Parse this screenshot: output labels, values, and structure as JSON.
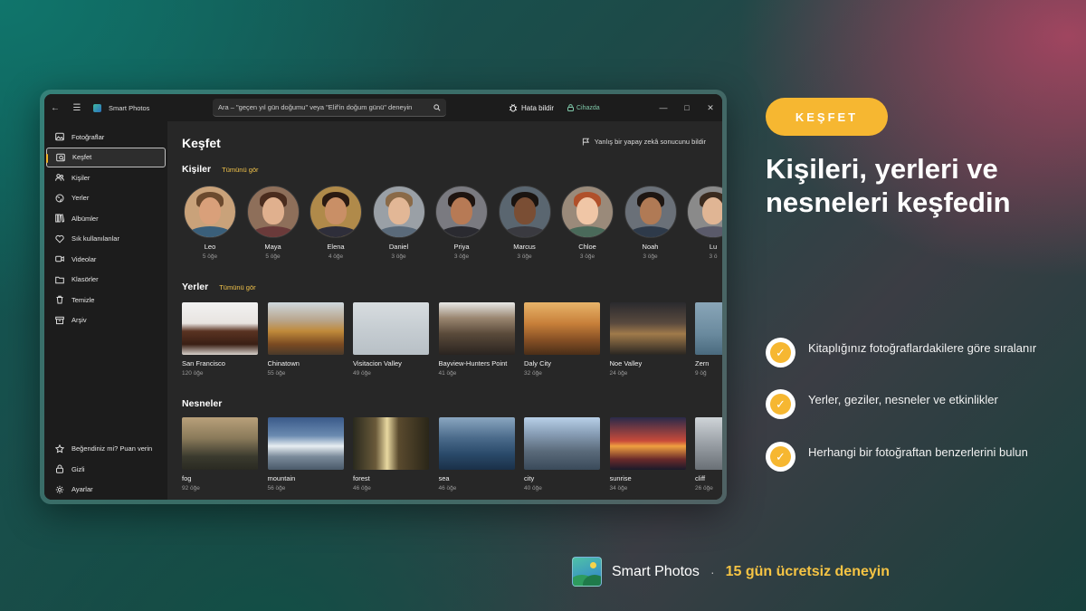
{
  "titlebar": {
    "app_title": "Smart Photos",
    "search_placeholder": "Ara – \"geçen yıl gün doğumu\" veya \"Elif'in doğum günü\" deneyin",
    "report_bug": "Hata bildir",
    "device": "Cihazda"
  },
  "sidebar": {
    "items": [
      {
        "label": "Fotoğraflar",
        "icon": "photo-icon"
      },
      {
        "label": "Keşfet",
        "icon": "explore-icon"
      },
      {
        "label": "Kişiler",
        "icon": "people-icon"
      },
      {
        "label": "Yerler",
        "icon": "globe-icon"
      },
      {
        "label": "Albümler",
        "icon": "album-icon"
      },
      {
        "label": "Sık kullanılanlar",
        "icon": "heart-icon"
      },
      {
        "label": "Videolar",
        "icon": "video-icon"
      },
      {
        "label": "Klasörler",
        "icon": "folder-icon"
      },
      {
        "label": "Temizle",
        "icon": "trash-icon"
      },
      {
        "label": "Arşiv",
        "icon": "archive-icon"
      }
    ],
    "bottom": [
      {
        "label": "Beğendiniz mi? Puan verin",
        "icon": "star-icon"
      },
      {
        "label": "Gizli",
        "icon": "lock-icon"
      },
      {
        "label": "Ayarlar",
        "icon": "gear-icon"
      }
    ]
  },
  "main": {
    "title": "Keşfet",
    "ai_report": "Yanlış bir yapay zekâ sonucunu bildir",
    "people": {
      "title": "Kişiler",
      "link": "Tümünü gör",
      "items": [
        {
          "name": "Leo",
          "count": "5 öğe"
        },
        {
          "name": "Maya",
          "count": "5 öğe"
        },
        {
          "name": "Elena",
          "count": "4 öğe"
        },
        {
          "name": "Daniel",
          "count": "3 öğe"
        },
        {
          "name": "Priya",
          "count": "3 öğe"
        },
        {
          "name": "Marcus",
          "count": "3 öğe"
        },
        {
          "name": "Chloe",
          "count": "3 öğe"
        },
        {
          "name": "Noah",
          "count": "3 öğe"
        },
        {
          "name": "Lu",
          "count": "3 ö"
        }
      ]
    },
    "places": {
      "title": "Yerler",
      "link": "Tümünü gör",
      "items": [
        {
          "name": "San Francisco",
          "count": "120 öğe"
        },
        {
          "name": "Chinatown",
          "count": "55 öğe"
        },
        {
          "name": "Visitacion Valley",
          "count": "49 öğe"
        },
        {
          "name": "Bayview-Hunters Point",
          "count": "41 öğe"
        },
        {
          "name": "Daly City",
          "count": "32 öğe"
        },
        {
          "name": "Noe Valley",
          "count": "24 öğe"
        },
        {
          "name": "Zern",
          "count": "9 öğ"
        }
      ]
    },
    "objects": {
      "title": "Nesneler",
      "items": [
        {
          "name": "fog",
          "count": "92 öğe"
        },
        {
          "name": "mountain",
          "count": "56 öğe"
        },
        {
          "name": "forest",
          "count": "46 öğe"
        },
        {
          "name": "sea",
          "count": "46 öğe"
        },
        {
          "name": "city",
          "count": "40 öğe"
        },
        {
          "name": "sunrise",
          "count": "34 öğe"
        },
        {
          "name": "cliff",
          "count": "26 öğe"
        }
      ]
    }
  },
  "promo": {
    "badge": "KEŞFET",
    "headline": "Kişileri, yerleri ve nesneleri keşfedin",
    "features": [
      "Kitaplığınız fotoğraflardakilere göre sıralanır",
      "Yerler, geziler, nesneler ve etkinlikler",
      "Herhangi bir fotoğraftan benzerlerini bulun"
    ]
  },
  "footer": {
    "brand": "Smart Photos",
    "separator": "·",
    "trial": "15 gün ücretsiz deneyin"
  },
  "colors": {
    "accent": "#f6b731",
    "link": "#f0c24a",
    "device_green": "#7fc8a9"
  }
}
